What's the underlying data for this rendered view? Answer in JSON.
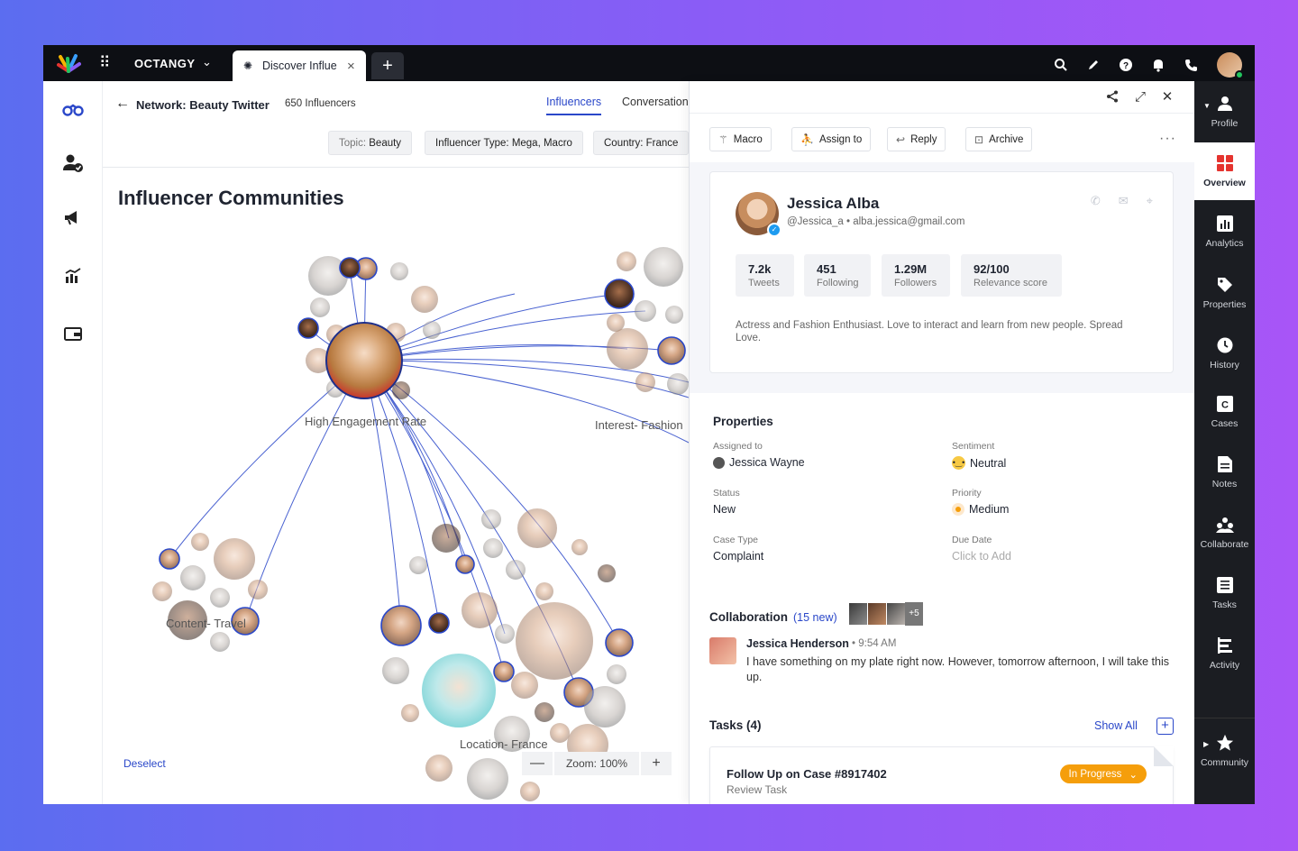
{
  "topbar": {
    "brand": "OCTANGY",
    "tab_label": "Discover Influe",
    "icons": [
      "search-icon",
      "edit-icon",
      "help-icon",
      "bell-icon",
      "phone-icon"
    ]
  },
  "leftnav": [
    "binoculars-icon",
    "user-check-icon",
    "megaphone-icon",
    "chart-icon",
    "wallet-icon"
  ],
  "main": {
    "network_title": "Network: Beauty Twitter",
    "influencer_count": "650 Influencers",
    "tabs": [
      {
        "label": "Influencers",
        "active": true
      },
      {
        "label": "Conversation",
        "active": false
      }
    ],
    "filters": [
      {
        "key": "Topic:",
        "value": "Beauty"
      },
      {
        "key": "",
        "value": "Influencer Type: Mega, Macro"
      },
      {
        "key": "",
        "value": "Country: France"
      }
    ],
    "section_title": "Influencer Communities",
    "clusters": [
      "High Engagement Rate",
      "Interest- Fashion",
      "Content- Travel",
      "Location- France"
    ],
    "deselect": "Deselect",
    "zoom_label": "Zoom: 100%",
    "zoom_minus": "—",
    "zoom_plus": "+"
  },
  "panel": {
    "actions": [
      {
        "label": "Macro",
        "icon": "wand-icon"
      },
      {
        "label": "Assign to",
        "icon": "assign-icon"
      },
      {
        "label": "Reply",
        "icon": "reply-icon"
      },
      {
        "label": "Archive",
        "icon": "archive-icon"
      }
    ],
    "profile": {
      "name": "Jessica Alba",
      "handle": "@Jessica_a",
      "email": "alba.jessica@gmail.com",
      "stats": [
        {
          "value": "7.2k",
          "label": "Tweets"
        },
        {
          "value": "451",
          "label": "Following"
        },
        {
          "value": "1.29M",
          "label": "Followers"
        },
        {
          "value": "92/100",
          "label": "Relevance score"
        }
      ],
      "bio": "Actress and Fashion Enthusiast. Love to interact and learn from new people. Spread Love."
    },
    "properties": {
      "title": "Properties",
      "items": [
        {
          "key": "Assigned to",
          "value": "Jessica Wayne"
        },
        {
          "key": "Sentiment",
          "value": "Neutral"
        },
        {
          "key": "Status",
          "value": "New"
        },
        {
          "key": "Priority",
          "value": "Medium"
        },
        {
          "key": "Case Type",
          "value": "Complaint"
        },
        {
          "key": "Due Date",
          "value": "Click to Add"
        }
      ]
    },
    "collaboration": {
      "title": "Collaboration",
      "new_count": "(15 new)",
      "more": "+5",
      "author": "Jessica Henderson",
      "time": "9:54 AM",
      "message": "I have something on my plate right now. However, tomorrow afternoon, I will take this up."
    },
    "tasks": {
      "title": "Tasks (4)",
      "show_all": "Show All",
      "task_name": "Follow Up on Case #8917402",
      "task_sub": "Review Task",
      "task_status": "In Progress"
    }
  },
  "rail": [
    {
      "label": "Profile",
      "icon": "user-icon"
    },
    {
      "label": "Overview",
      "icon": "overview-icon",
      "active": true
    },
    {
      "label": "Analytics",
      "icon": "analytics-icon"
    },
    {
      "label": "Properties",
      "icon": "tag-icon"
    },
    {
      "label": "History",
      "icon": "clock-icon"
    },
    {
      "label": "Cases",
      "icon": "case-icon"
    },
    {
      "label": "Notes",
      "icon": "notes-icon"
    },
    {
      "label": "Collaborate",
      "icon": "collaborate-icon"
    },
    {
      "label": "Tasks",
      "icon": "tasks-icon"
    },
    {
      "label": "Activity",
      "icon": "activity-icon"
    },
    {
      "label": "Community",
      "icon": "star-icon"
    }
  ],
  "colors": {
    "accent": "#2a47c9",
    "status_orange": "#f59e0b",
    "topbar": "#0d0f14",
    "rail": "#1b1d22"
  }
}
